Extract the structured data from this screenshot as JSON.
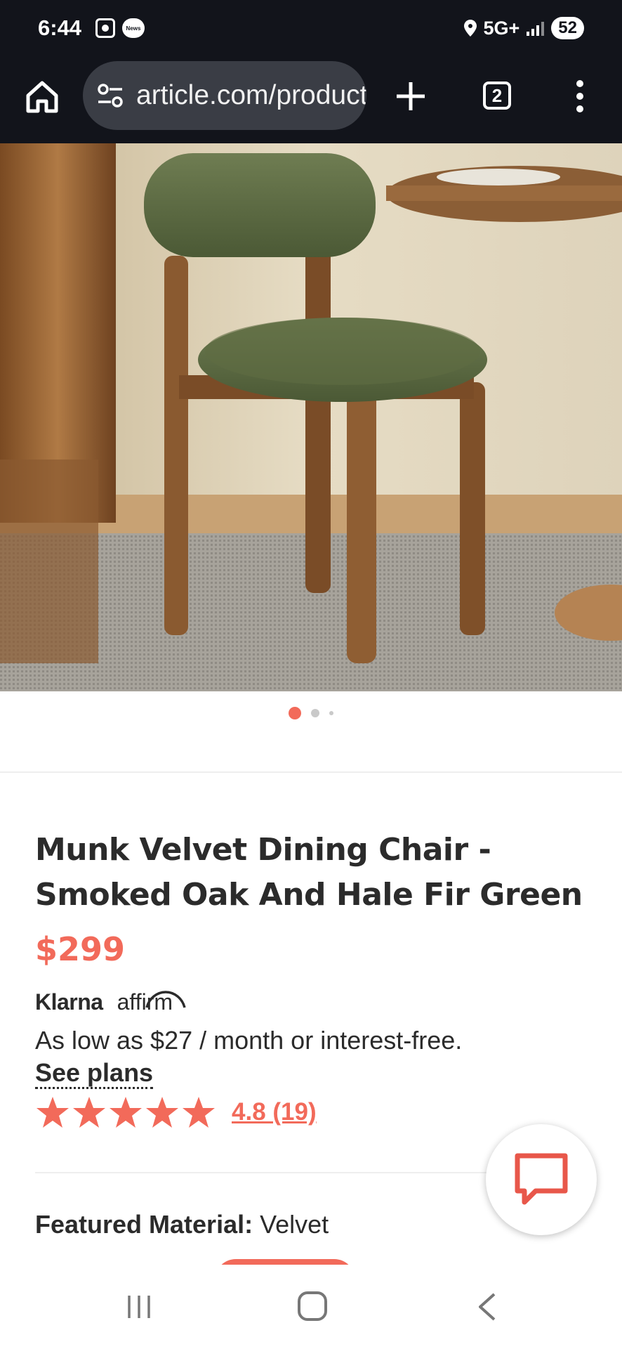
{
  "status_bar": {
    "time": "6:44",
    "notification_news_label": "News",
    "network": "5G+",
    "battery": "52",
    "icons": [
      "screenshot-icon",
      "news-icon",
      "location-pin-icon",
      "signal-icon",
      "battery-icon"
    ]
  },
  "browser": {
    "url": "article.com/product",
    "tab_count": "2",
    "icons": [
      "home-icon",
      "site-settings-icon",
      "new-tab-plus-icon",
      "tabs-icon",
      "more-menu-icon"
    ]
  },
  "product": {
    "image_alt": "Green velvet dining chair with smoked oak frame",
    "carousel": {
      "total": 3,
      "active": 1
    },
    "title": "Munk Velvet Dining Chair - Smoked Oak And Hale Fir Green",
    "price": "$299",
    "bnpl": {
      "klarna": "Klarna",
      "affirm": "affirm",
      "text": "As low as $27 / month or interest-free.",
      "link": "See plans"
    },
    "rating": {
      "stars": 5,
      "text": "4.8 (19)"
    },
    "featured_material": {
      "label": "Featured Material:",
      "value": "Velvet"
    }
  },
  "colors": {
    "accent": "#f26a5a",
    "dark_bar": "#12141b",
    "text": "#2b2b2b"
  },
  "nav_bar": {
    "icons": [
      "recents-icon",
      "home-nav-icon",
      "back-icon"
    ]
  }
}
